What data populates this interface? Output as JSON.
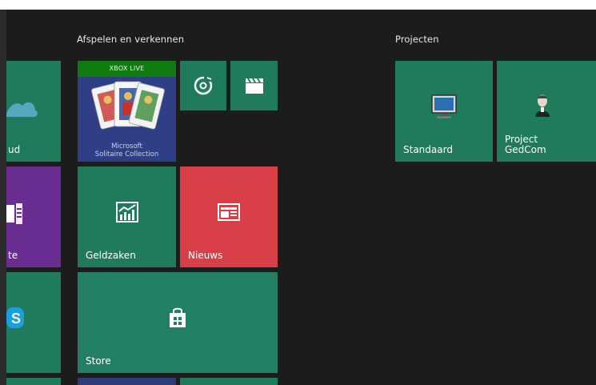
{
  "groups": {
    "play": {
      "label": "Afspelen en verkennen"
    },
    "projects": {
      "label": "Projecten"
    }
  },
  "tiles": {
    "cloud": {
      "label": "ud"
    },
    "onenote": {
      "label": "te"
    },
    "solitaire": {
      "badge": "XBOX LIVE",
      "caption_line1": "Microsoft",
      "caption_line2": "Solitaire Collection"
    },
    "music": {
      "icon": "groove-music-icon"
    },
    "video": {
      "icon": "clapperboard-icon"
    },
    "finance": {
      "label": "Geldzaken",
      "icon": "finance-chart-icon"
    },
    "news": {
      "label": "Nieuws",
      "icon": "news-icon"
    },
    "store": {
      "label": "Store",
      "icon": "store-bag-icon"
    },
    "standaard": {
      "label": "Standaard",
      "icon": "monitor-icon"
    },
    "gedcom": {
      "label_line1": "Project",
      "label_line2": "GedCom",
      "icon": "portrait-icon"
    }
  },
  "colors": {
    "tile_green": "#1f7a5e",
    "tile_purple": "#6a2d92",
    "tile_red": "#d64046",
    "tile_navy": "#2d3b7a",
    "xbox_green": "#107c10",
    "background": "#1c1c1c"
  }
}
